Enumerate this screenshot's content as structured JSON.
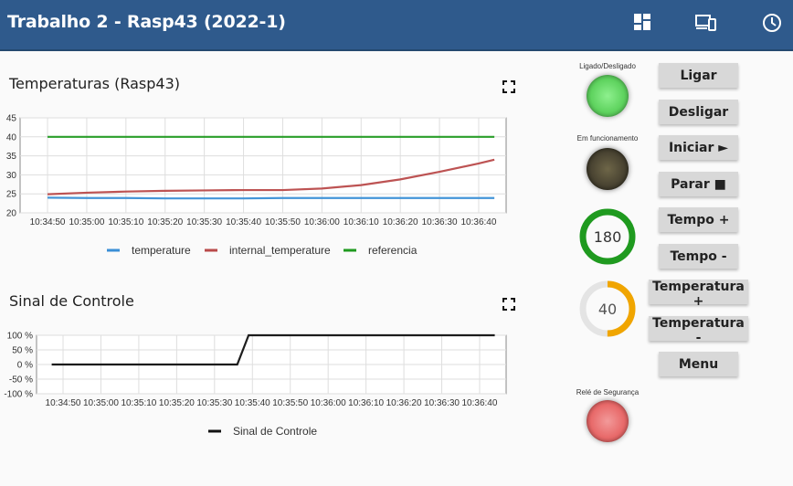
{
  "header": {
    "title": "Trabalho 2 - Rasp43 (2022-1)",
    "icons": [
      "dashboard-icon",
      "devices-icon",
      "clock-icon"
    ],
    "bg": "#2f5a8c"
  },
  "temp_panel": {
    "title": "Temperaturas (Rasp43)"
  },
  "signal_panel": {
    "title": "Sinal de Controle"
  },
  "chart_data": [
    {
      "type": "line",
      "title": "Temperaturas (Rasp43)",
      "xlabel": "",
      "ylabel": "",
      "ylim": [
        20,
        45
      ],
      "yticks": [
        45,
        40,
        35,
        30,
        25,
        20
      ],
      "xticks": [
        "10:34:50",
        "10:35:00",
        "10:35:10",
        "10:35:20",
        "10:35:30",
        "10:35:40",
        "10:35:50",
        "10:36:00",
        "10:36:10",
        "10:36:20",
        "10:36:30",
        "10:36:40"
      ],
      "x_seconds": [
        0,
        10,
        20,
        30,
        40,
        50,
        60,
        70,
        80,
        90,
        100,
        110,
        114
      ],
      "grid": true,
      "legend": "bottom",
      "series": [
        {
          "name": "temperature",
          "color": "#3a8fd6",
          "values": [
            24.0,
            23.9,
            23.9,
            23.8,
            23.8,
            23.8,
            23.9,
            23.9,
            23.9,
            23.9,
            23.9,
            23.9,
            23.9
          ]
        },
        {
          "name": "internal_temperature",
          "color": "#b94a4a",
          "values": [
            24.9,
            25.3,
            25.6,
            25.8,
            25.9,
            26.0,
            26.0,
            26.4,
            27.3,
            28.8,
            30.8,
            33.0,
            34.0
          ]
        },
        {
          "name": "referencia",
          "color": "#1f9a1f",
          "values": [
            40,
            40,
            40,
            40,
            40,
            40,
            40,
            40,
            40,
            40,
            40,
            40,
            40
          ]
        }
      ]
    },
    {
      "type": "line",
      "title": "Sinal de Controle",
      "ylim": [
        -100,
        100
      ],
      "yticks": [
        "100 %",
        "50 %",
        "0 %",
        "-50 %",
        "-100 %"
      ],
      "ytick_values": [
        100,
        50,
        0,
        -50,
        -100
      ],
      "xticks": [
        "10:34:50",
        "10:35:00",
        "10:35:10",
        "10:35:20",
        "10:35:30",
        "10:35:40",
        "10:35:50",
        "10:36:00",
        "10:36:10",
        "10:36:20",
        "10:36:30",
        "10:36:40"
      ],
      "x_seconds": [
        -3,
        46,
        49,
        114
      ],
      "grid": true,
      "legend": "bottom",
      "series": [
        {
          "name": "Sinal de Controle",
          "color": "#111111",
          "values": [
            0,
            0,
            100,
            100
          ]
        }
      ]
    }
  ],
  "status": {
    "onoff_label": "Ligado/Desligado",
    "running_label": "Em funcionamento",
    "relay_label": "Relé de Segurança",
    "onoff_color": "#5fd35f",
    "running_color": "#4a4432",
    "relay_color": "#e86a6a"
  },
  "gauges": {
    "time": {
      "value": "180",
      "fraction": 1.0,
      "color": "#1f9a1f"
    },
    "temp": {
      "value": "40",
      "fraction": 0.5,
      "color": "#f0a500"
    }
  },
  "buttons": {
    "ligar": "Ligar",
    "desligar": "Desligar",
    "iniciar": "Iniciar ►",
    "parar": "Parar ■",
    "tempo_mais": "Tempo +",
    "tempo_menos": "Tempo -",
    "temp_mais": "Temperatura +",
    "temp_menos": "Temperatura -",
    "menu": "Menu"
  }
}
